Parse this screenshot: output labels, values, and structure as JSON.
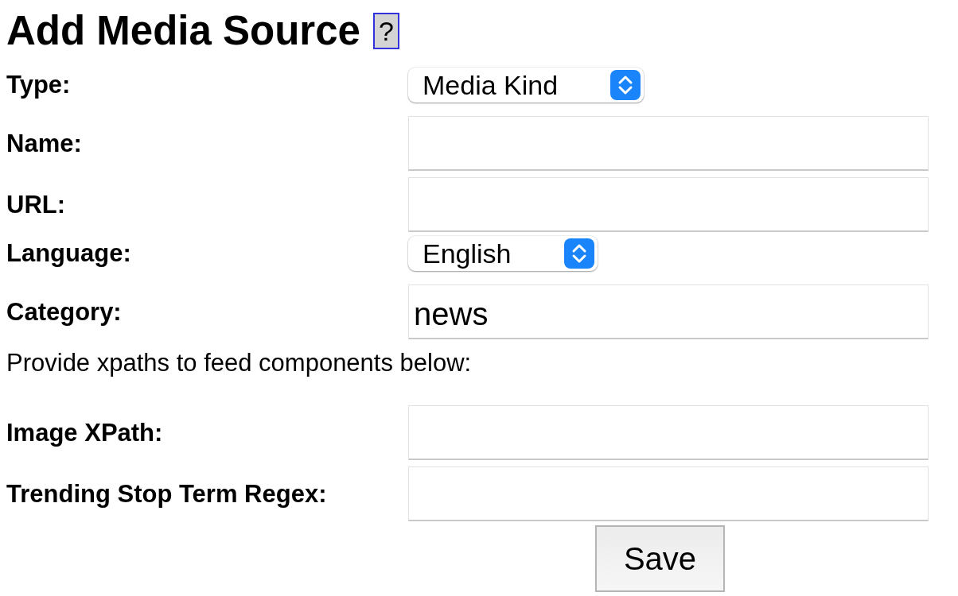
{
  "title": "Add Media Source",
  "help_button": {
    "label": "?"
  },
  "fields": [
    {
      "kind": "select",
      "label": "Type:",
      "value": "Media Kind"
    },
    {
      "kind": "input",
      "label": "Name:"
    },
    {
      "kind": "input",
      "label": "URL:"
    },
    {
      "kind": "select",
      "label": "Language:",
      "value": "English"
    },
    {
      "kind": "input",
      "label": "Category:",
      "value": "news"
    }
  ],
  "note": "Provide xpaths to feed components below:",
  "xpath_fields": [
    {
      "kind": "input",
      "label": "Image XPath:"
    },
    {
      "kind": "input",
      "label": "Trending Stop Term Regex:"
    }
  ],
  "save_button": {
    "label": "Save"
  }
}
